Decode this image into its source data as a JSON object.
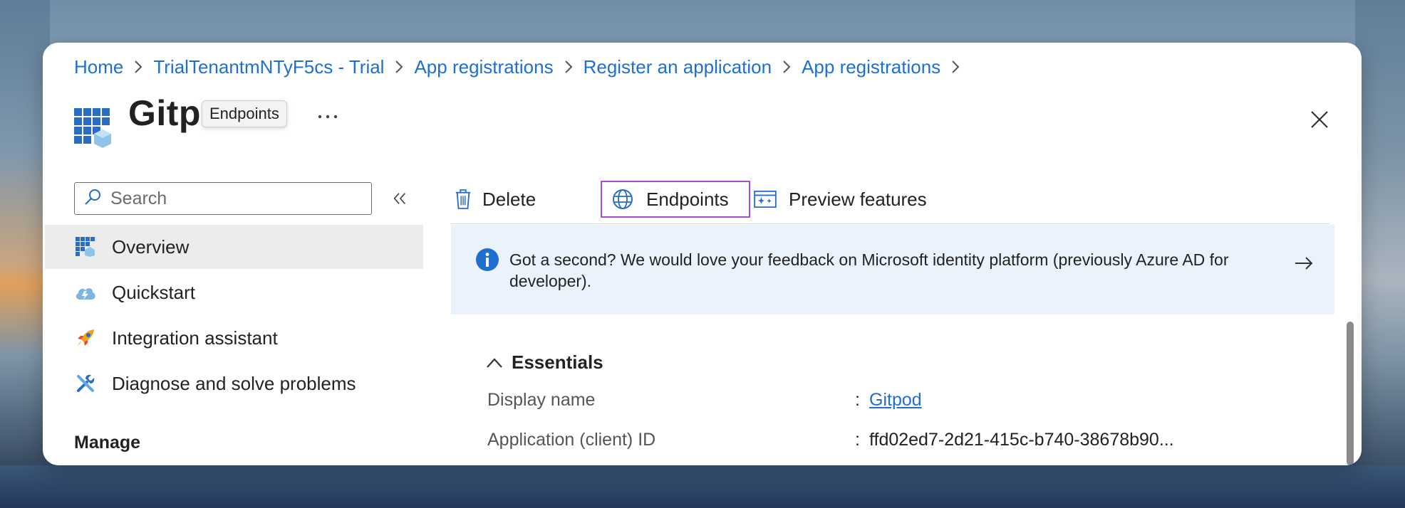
{
  "breadcrumb": {
    "items": [
      "Home",
      "TrialTenantmNTyF5cs - Trial",
      "App registrations",
      "Register an application",
      "App registrations"
    ]
  },
  "header": {
    "title": "Gitpod",
    "tooltip": "Endpoints",
    "more_label": "···"
  },
  "sidebar": {
    "search_placeholder": "Search",
    "items": [
      {
        "label": "Overview",
        "icon": "app-grid-icon",
        "active": true
      },
      {
        "label": "Quickstart",
        "icon": "cloud-icon",
        "active": false
      },
      {
        "label": "Integration assistant",
        "icon": "rocket-icon",
        "active": false
      },
      {
        "label": "Diagnose and solve problems",
        "icon": "wrench-icon",
        "active": false
      }
    ],
    "section_label": "Manage"
  },
  "toolbar": {
    "delete_label": "Delete",
    "endpoints_label": "Endpoints",
    "preview_label": "Preview features"
  },
  "banner": {
    "text": "Got a second? We would love your feedback on Microsoft identity platform (previously Azure AD for developer)."
  },
  "essentials": {
    "title": "Essentials",
    "properties": [
      {
        "label": "Display name",
        "value": "Gitpod",
        "is_link": true
      },
      {
        "label": "Application (client) ID",
        "value": "ffd02ed7-2d21-415c-b740-38678b90...",
        "is_link": false
      }
    ]
  },
  "colors": {
    "accent": "#1f6fd1",
    "focus_outline": "#a94ad1",
    "banner_bg": "#eaf3fc",
    "active_nav_bg": "#ececeb"
  }
}
